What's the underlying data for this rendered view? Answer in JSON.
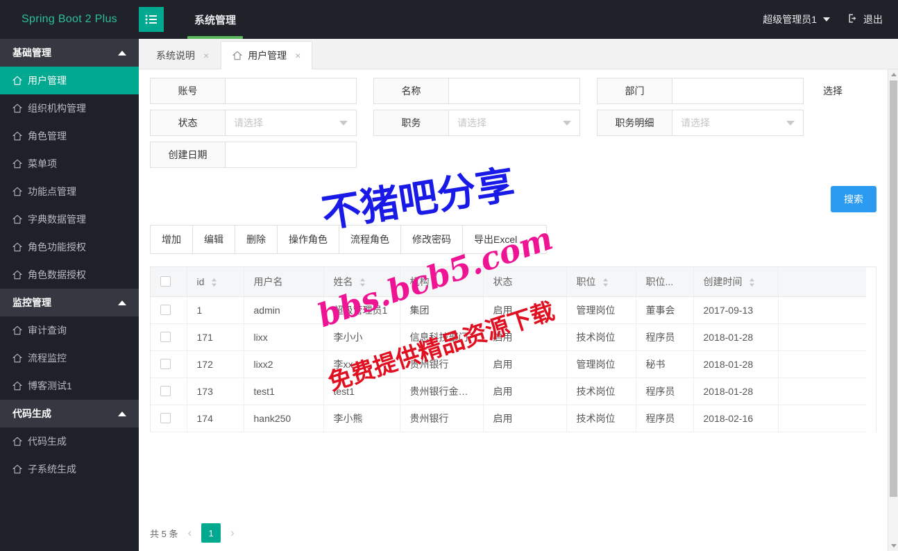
{
  "topbar": {
    "brand": "Spring Boot 2 Plus",
    "menu_icon": "hamburger-list-icon",
    "nav": [
      {
        "label": "系统管理",
        "active": true
      }
    ],
    "user": "超级管理员1",
    "logout": "退出",
    "logout_icon": "logout-icon"
  },
  "sidebar": {
    "groups": [
      {
        "label": "基础管理",
        "items": [
          {
            "label": "用户管理",
            "active": true
          },
          {
            "label": "组织机构管理",
            "active": false
          },
          {
            "label": "角色管理",
            "active": false
          },
          {
            "label": "菜单项",
            "active": false
          },
          {
            "label": "功能点管理",
            "active": false
          },
          {
            "label": "字典数据管理",
            "active": false
          },
          {
            "label": "角色功能授权",
            "active": false
          },
          {
            "label": "角色数据授权",
            "active": false
          }
        ]
      },
      {
        "label": "监控管理",
        "items": [
          {
            "label": "审计查询",
            "active": false
          },
          {
            "label": "流程监控",
            "active": false
          },
          {
            "label": "博客测试1",
            "active": false
          }
        ]
      },
      {
        "label": "代码生成",
        "items": [
          {
            "label": "代码生成",
            "active": false
          },
          {
            "label": "子系统生成",
            "active": false
          }
        ]
      }
    ]
  },
  "tabs": [
    {
      "label": "系统说明",
      "active": false,
      "close": "×",
      "has_home_icon": false
    },
    {
      "label": "用户管理",
      "active": true,
      "close": "×",
      "has_home_icon": true
    }
  ],
  "search_form": {
    "fields": [
      {
        "label": "账号",
        "value": "",
        "type": "text"
      },
      {
        "label": "名称",
        "value": "",
        "type": "text"
      },
      {
        "label": "部门",
        "value": "",
        "type": "text"
      },
      {
        "label": "状态",
        "value": "请选择",
        "type": "select"
      },
      {
        "label": "职务",
        "value": "请选择",
        "type": "select"
      },
      {
        "label": "职务明细",
        "value": "请选择",
        "type": "select"
      },
      {
        "label": "创建日期",
        "value": "",
        "type": "text"
      }
    ],
    "choose_link": "选择",
    "search_button": "搜索"
  },
  "toolbar": {
    "buttons": [
      "增加",
      "编辑",
      "删除",
      "操作角色",
      "流程角色",
      "修改密码",
      "导出Excel"
    ]
  },
  "table": {
    "columns": [
      {
        "key": "check",
        "label": "",
        "sortable": false
      },
      {
        "key": "id",
        "label": "id",
        "sortable": true
      },
      {
        "key": "user",
        "label": "用户名",
        "sortable": false
      },
      {
        "key": "name",
        "label": "姓名",
        "sortable": true
      },
      {
        "key": "org",
        "label": "机构",
        "sortable": false
      },
      {
        "key": "status",
        "label": "状态",
        "sortable": false
      },
      {
        "key": "pos",
        "label": "职位",
        "sortable": true
      },
      {
        "key": "posd",
        "label": "职位...",
        "sortable": false
      },
      {
        "key": "time",
        "label": "创建时间",
        "sortable": true
      },
      {
        "key": "pad",
        "label": "",
        "sortable": false
      }
    ],
    "rows": [
      {
        "id": "1",
        "user": "admin",
        "name": "超级管理员1",
        "org": "集团",
        "status": "启用",
        "pos": "管理岗位",
        "posd": "董事会",
        "time": "2017-09-13"
      },
      {
        "id": "171",
        "user": "lixx",
        "name": "李小小",
        "org": "信息科技部门",
        "status": "启用",
        "pos": "技术岗位",
        "posd": "程序员",
        "time": "2018-01-28"
      },
      {
        "id": "172",
        "user": "lixx2",
        "name": "李xx",
        "org": "贵州银行",
        "status": "启用",
        "pos": "管理岗位",
        "posd": "秘书",
        "time": "2018-01-28"
      },
      {
        "id": "173",
        "user": "test1",
        "name": "test1",
        "org": "贵州银行金…",
        "status": "启用",
        "pos": "技术岗位",
        "posd": "程序员",
        "time": "2018-01-28"
      },
      {
        "id": "174",
        "user": "hank250",
        "name": "李小熊",
        "org": "贵州银行",
        "status": "启用",
        "pos": "技术岗位",
        "posd": "程序员",
        "time": "2018-02-16"
      }
    ]
  },
  "pager": {
    "total_text": "共 5 条",
    "prev": "‹",
    "next": "›",
    "current_page": "1"
  },
  "watermarks": {
    "line1": "不猪吧分享",
    "line2": "bbs.bcb5.com",
    "line3": "免费提供精品资源下载"
  },
  "colors": {
    "brand_green": "#2dbf9c",
    "accent_green": "#00a98f",
    "topbar_dark": "#20222a",
    "sidebar_dark": "#1f212a",
    "sidebar_group": "#353841",
    "search_blue": "#2a9bf0",
    "nav_underline": "#5cb85c"
  }
}
